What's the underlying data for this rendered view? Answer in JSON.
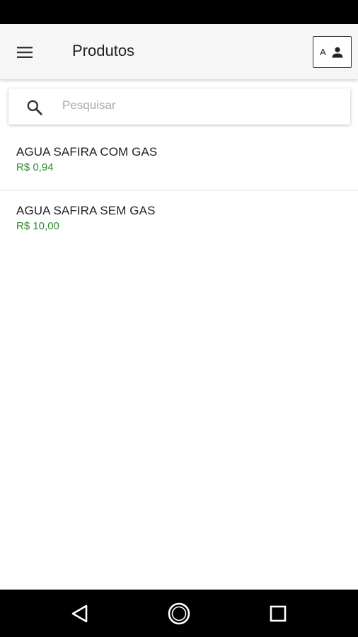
{
  "app_bar": {
    "title": "Produtos",
    "account_letter": "A",
    "menu_icon": "menu-icon",
    "account_icon": "person-icon"
  },
  "search": {
    "placeholder": "Pesquisar",
    "value": "",
    "icon": "search-icon"
  },
  "products": [
    {
      "name": "AGUA SAFIRA COM GAS",
      "price": "R$ 0,94"
    },
    {
      "name": "AGUA SAFIRA SEM GAS",
      "price": "R$ 10,00"
    }
  ],
  "nav_bar": {
    "icons": [
      "back-icon",
      "home-icon",
      "recents-icon"
    ]
  },
  "colors": {
    "price": "#2e8b2e",
    "app_bar_bg": "#f6f6f6",
    "system_bars": "#000000"
  }
}
